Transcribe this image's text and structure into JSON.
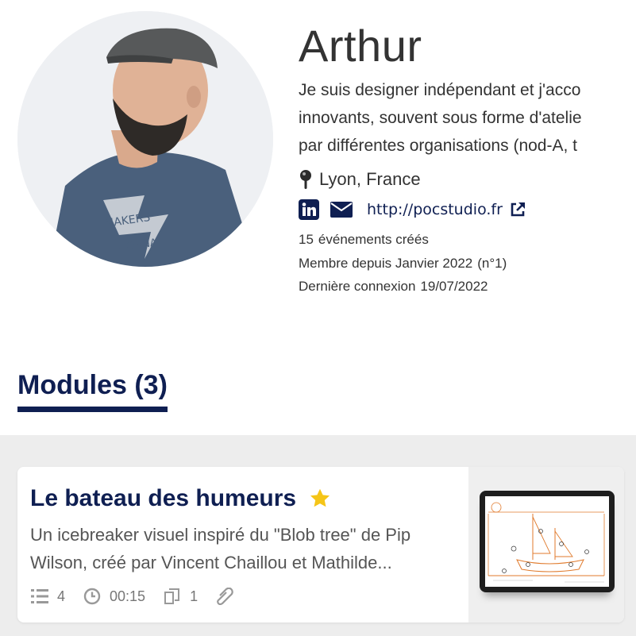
{
  "profile": {
    "name": "Arthur",
    "bio_lines": [
      "Je suis designer indépendant et j'acco",
      "innovants, souvent sous forme d'atelie",
      "par différentes organisations (nod-A, t"
    ],
    "location": "Lyon, France",
    "website": "http://pocstudio.fr",
    "stats": {
      "events_count": "15",
      "events_label": "événements créés",
      "member_since": "Membre depuis Janvier 2022",
      "member_rank": "(n°1)",
      "last_login_label": "Dernière connexion",
      "last_login_date": "19/07/2022"
    }
  },
  "modules": {
    "title": "Modules (3)",
    "items": [
      {
        "title": "Le bateau des humeurs",
        "starred": true,
        "description": "Un icebreaker visuel inspiré du \"Blob tree\" de Pip Wilson, créé par Vincent Chaillou et Mathilde...",
        "steps": "4",
        "duration": "00:15",
        "copies": "1"
      }
    ]
  },
  "colors": {
    "primary": "#0f1f52",
    "accent_star": "#f5c518",
    "modules_bg": "#ededed",
    "text": "#333333",
    "muted": "#777777",
    "illustration_orange": "#e07a2c"
  },
  "icons": [
    "map-pin-icon",
    "linkedin-icon",
    "mail-icon",
    "external-link-icon",
    "star-icon",
    "list-icon",
    "clock-icon",
    "copy-icon",
    "paperclip-icon"
  ]
}
